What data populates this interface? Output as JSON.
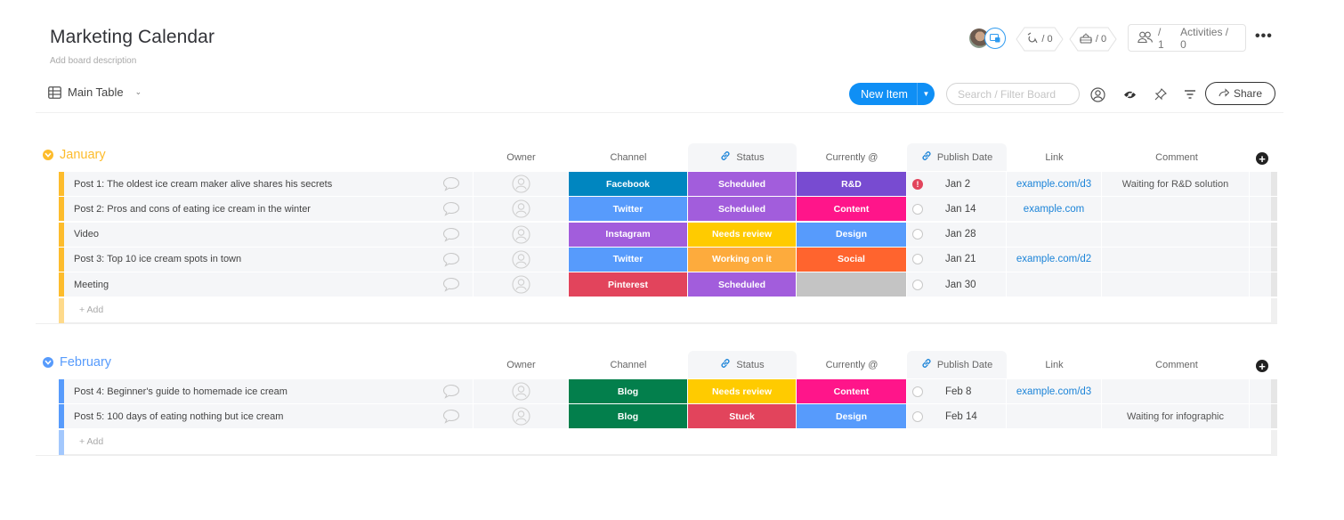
{
  "board": {
    "title": "Marketing Calendar",
    "description_placeholder": "Add board description",
    "view": "Main Table"
  },
  "header": {
    "automations_count": "/ 0",
    "integrations_count": "/ 0",
    "members_count": "/ 1",
    "activities_label": "Activities / 0"
  },
  "toolbar": {
    "new_item_label": "New Item",
    "search_placeholder": "Search / Filter Board",
    "share_label": "Share"
  },
  "columns": {
    "owner": "Owner",
    "channel": "Channel",
    "status": "Status",
    "currently": "Currently @",
    "publish_date": "Publish Date",
    "link": "Link",
    "comment": "Comment"
  },
  "colors": {
    "accent": "#0f8ff5",
    "january": "#fdbc2c",
    "february": "#579bfc",
    "link": "#1c84d8"
  },
  "groups": [
    {
      "name": "January",
      "color": "#fdbc2c",
      "add_label": "+ Add",
      "rows": [
        {
          "name": "Post 1: The oldest ice cream maker alive shares his secrets",
          "channel": "Facebook",
          "channel_color": "#0086c0",
          "status": "Scheduled",
          "status_color": "#a25ddc",
          "currently": "R&D",
          "currently_color": "#784bd1",
          "alert": true,
          "date": "Jan 2",
          "link": "example.com/d3",
          "comment": "Waiting for R&D solution"
        },
        {
          "name": "Post 2: Pros and cons of eating ice cream in the winter",
          "channel": "Twitter",
          "channel_color": "#579bfc",
          "status": "Scheduled",
          "status_color": "#a25ddc",
          "currently": "Content",
          "currently_color": "#ff158a",
          "alert": false,
          "date": "Jan 14",
          "link": "example.com",
          "comment": ""
        },
        {
          "name": "Video",
          "channel": "Instagram",
          "channel_color": "#a25ddc",
          "status": "Needs review",
          "status_color": "#ffcb00",
          "currently": "Design",
          "currently_color": "#579bfc",
          "alert": false,
          "date": "Jan 28",
          "link": "",
          "comment": ""
        },
        {
          "name": "Post 3: Top 10 ice cream spots in town",
          "channel": "Twitter",
          "channel_color": "#579bfc",
          "status": "Working on it",
          "status_color": "#fdab3d",
          "currently": "Social",
          "currently_color": "#ff642e",
          "alert": false,
          "date": "Jan 21",
          "link": "example.com/d2",
          "comment": ""
        },
        {
          "name": "Meeting",
          "channel": "Pinterest",
          "channel_color": "#e2445c",
          "status": "Scheduled",
          "status_color": "#a25ddc",
          "currently": "",
          "currently_color": "#c4c4c4",
          "alert": false,
          "date": "Jan 30",
          "link": "",
          "comment": ""
        }
      ]
    },
    {
      "name": "February",
      "color": "#579bfc",
      "add_label": "+ Add",
      "rows": [
        {
          "name": "Post 4: Beginner's guide to homemade ice cream",
          "channel": "Blog",
          "channel_color": "#037f4c",
          "status": "Needs review",
          "status_color": "#ffcb00",
          "currently": "Content",
          "currently_color": "#ff158a",
          "alert": false,
          "date": "Feb 8",
          "link": "example.com/d3",
          "comment": ""
        },
        {
          "name": "Post 5: 100 days of eating nothing but ice cream",
          "channel": "Blog",
          "channel_color": "#037f4c",
          "status": "Stuck",
          "status_color": "#e2445c",
          "currently": "Design",
          "currently_color": "#579bfc",
          "alert": false,
          "date": "Feb 14",
          "link": "",
          "comment": "Waiting for infographic"
        }
      ]
    }
  ]
}
